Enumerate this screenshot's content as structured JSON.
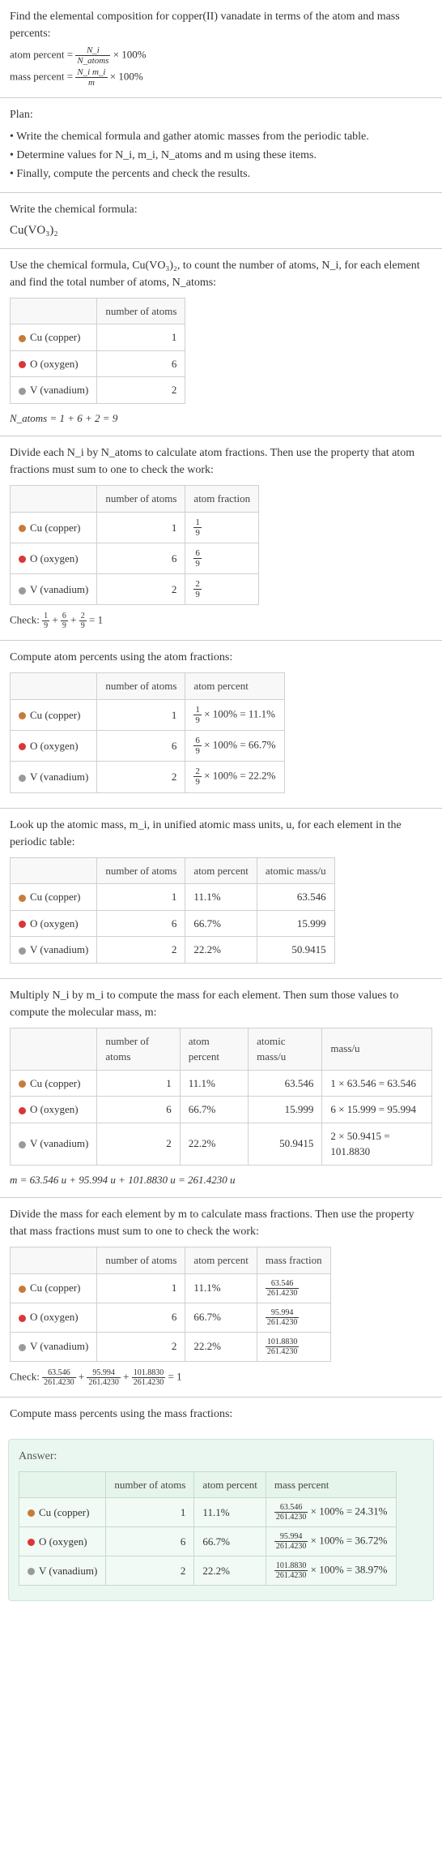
{
  "intro": {
    "prompt": "Find the elemental composition for copper(II) vanadate in terms of the atom and mass percents:",
    "atom_percent_label": "atom percent = ",
    "atom_percent_frac_num": "N_i",
    "atom_percent_frac_den": "N_atoms",
    "times100": " × 100%",
    "mass_percent_label": "mass percent = ",
    "mass_percent_frac_num": "N_i m_i",
    "mass_percent_frac_den": "m"
  },
  "plan": {
    "title": "Plan:",
    "items": [
      "Write the chemical formula and gather atomic masses from the periodic table.",
      "Determine values for N_i, m_i, N_atoms and m using these items.",
      "Finally, compute the percents and check the results."
    ]
  },
  "write_formula": {
    "title": "Write the chemical formula:",
    "formula_text": "Cu(VO₃)₂"
  },
  "count_atoms": {
    "text": "Use the chemical formula, Cu(VO₃)₂, to count the number of atoms, N_i, for each element and find the total number of atoms, N_atoms:",
    "header_blank": "",
    "header_num": "number of atoms",
    "rows": [
      {
        "name": "Cu (copper)",
        "color": "dot-cu",
        "n": "1"
      },
      {
        "name": "O (oxygen)",
        "color": "dot-o",
        "n": "6"
      },
      {
        "name": "V (vanadium)",
        "color": "dot-v",
        "n": "2"
      }
    ],
    "sum": "N_atoms = 1 + 6 + 2 = 9"
  },
  "atom_fractions": {
    "text": "Divide each N_i by N_atoms to calculate atom fractions. Then use the property that atom fractions must sum to one to check the work:",
    "header_num": "number of atoms",
    "header_frac": "atom fraction",
    "rows": [
      {
        "name": "Cu (copper)",
        "color": "dot-cu",
        "n": "1",
        "frac_num": "1",
        "frac_den": "9"
      },
      {
        "name": "O (oxygen)",
        "color": "dot-o",
        "n": "6",
        "frac_num": "6",
        "frac_den": "9"
      },
      {
        "name": "V (vanadium)",
        "color": "dot-v",
        "n": "2",
        "frac_num": "2",
        "frac_den": "9"
      }
    ],
    "check_label": "Check: ",
    "check_expr": " = 1"
  },
  "atom_percents": {
    "text": "Compute atom percents using the atom fractions:",
    "header_num": "number of atoms",
    "header_pct": "atom percent",
    "rows": [
      {
        "name": "Cu (copper)",
        "color": "dot-cu",
        "n": "1",
        "frac_num": "1",
        "frac_den": "9",
        "result": " × 100% = 11.1%"
      },
      {
        "name": "O (oxygen)",
        "color": "dot-o",
        "n": "6",
        "frac_num": "6",
        "frac_den": "9",
        "result": " × 100% = 66.7%"
      },
      {
        "name": "V (vanadium)",
        "color": "dot-v",
        "n": "2",
        "frac_num": "2",
        "frac_den": "9",
        "result": " × 100% = 22.2%"
      }
    ]
  },
  "atomic_mass": {
    "text": "Look up the atomic mass, m_i, in unified atomic mass units, u, for each element in the periodic table:",
    "header_num": "number of atoms",
    "header_pct": "atom percent",
    "header_mass": "atomic mass/u",
    "rows": [
      {
        "name": "Cu (copper)",
        "color": "dot-cu",
        "n": "1",
        "pct": "11.1%",
        "mass": "63.546"
      },
      {
        "name": "O (oxygen)",
        "color": "dot-o",
        "n": "6",
        "pct": "66.7%",
        "mass": "15.999"
      },
      {
        "name": "V (vanadium)",
        "color": "dot-v",
        "n": "2",
        "pct": "22.2%",
        "mass": "50.9415"
      }
    ]
  },
  "multiply": {
    "text": "Multiply N_i by m_i to compute the mass for each element. Then sum those values to compute the molecular mass, m:",
    "header_num": "number of atoms",
    "header_pct": "atom percent",
    "header_amu": "atomic mass/u",
    "header_massu": "mass/u",
    "rows": [
      {
        "name": "Cu (copper)",
        "color": "dot-cu",
        "n": "1",
        "pct": "11.1%",
        "amu": "63.546",
        "calc": "1 × 63.546 = 63.546"
      },
      {
        "name": "O (oxygen)",
        "color": "dot-o",
        "n": "6",
        "pct": "66.7%",
        "amu": "15.999",
        "calc": "6 × 15.999 = 95.994"
      },
      {
        "name": "V (vanadium)",
        "color": "dot-v",
        "n": "2",
        "pct": "22.2%",
        "amu": "50.9415",
        "calc": "2 × 50.9415 = 101.8830"
      }
    ],
    "sum": "m = 63.546 u + 95.994 u + 101.8830 u = 261.4230 u"
  },
  "mass_fractions": {
    "text": "Divide the mass for each element by m to calculate mass fractions. Then use the property that mass fractions must sum to one to check the work:",
    "header_num": "number of atoms",
    "header_pct": "atom percent",
    "header_mf": "mass fraction",
    "rows": [
      {
        "name": "Cu (copper)",
        "color": "dot-cu",
        "n": "1",
        "pct": "11.1%",
        "frac_num": "63.546",
        "frac_den": "261.4230"
      },
      {
        "name": "O (oxygen)",
        "color": "dot-o",
        "n": "6",
        "pct": "66.7%",
        "frac_num": "95.994",
        "frac_den": "261.4230"
      },
      {
        "name": "V (vanadium)",
        "color": "dot-v",
        "n": "2",
        "pct": "22.2%",
        "frac_num": "101.8830",
        "frac_den": "261.4230"
      }
    ],
    "check_label": "Check: ",
    "check_expr": " = 1",
    "f1n": "63.546",
    "f1d": "261.4230",
    "f2n": "95.994",
    "f2d": "261.4230",
    "f3n": "101.8830",
    "f3d": "261.4230"
  },
  "mass_percents_intro": "Compute mass percents using the mass fractions:",
  "answer": {
    "label": "Answer:",
    "header_num": "number of atoms",
    "header_apct": "atom percent",
    "header_mpct": "mass percent",
    "rows": [
      {
        "name": "Cu (copper)",
        "color": "dot-cu",
        "n": "1",
        "apct": "11.1%",
        "frac_num": "63.546",
        "frac_den": "261.4230",
        "tail": " × 100% = 24.31%"
      },
      {
        "name": "O (oxygen)",
        "color": "dot-o",
        "n": "6",
        "apct": "66.7%",
        "frac_num": "95.994",
        "frac_den": "261.4230",
        "tail": " × 100% = 36.72%"
      },
      {
        "name": "V (vanadium)",
        "color": "dot-v",
        "n": "2",
        "apct": "22.2%",
        "frac_num": "101.8830",
        "frac_den": "261.4230",
        "tail": " × 100% = 38.97%"
      }
    ]
  },
  "plus": " + "
}
